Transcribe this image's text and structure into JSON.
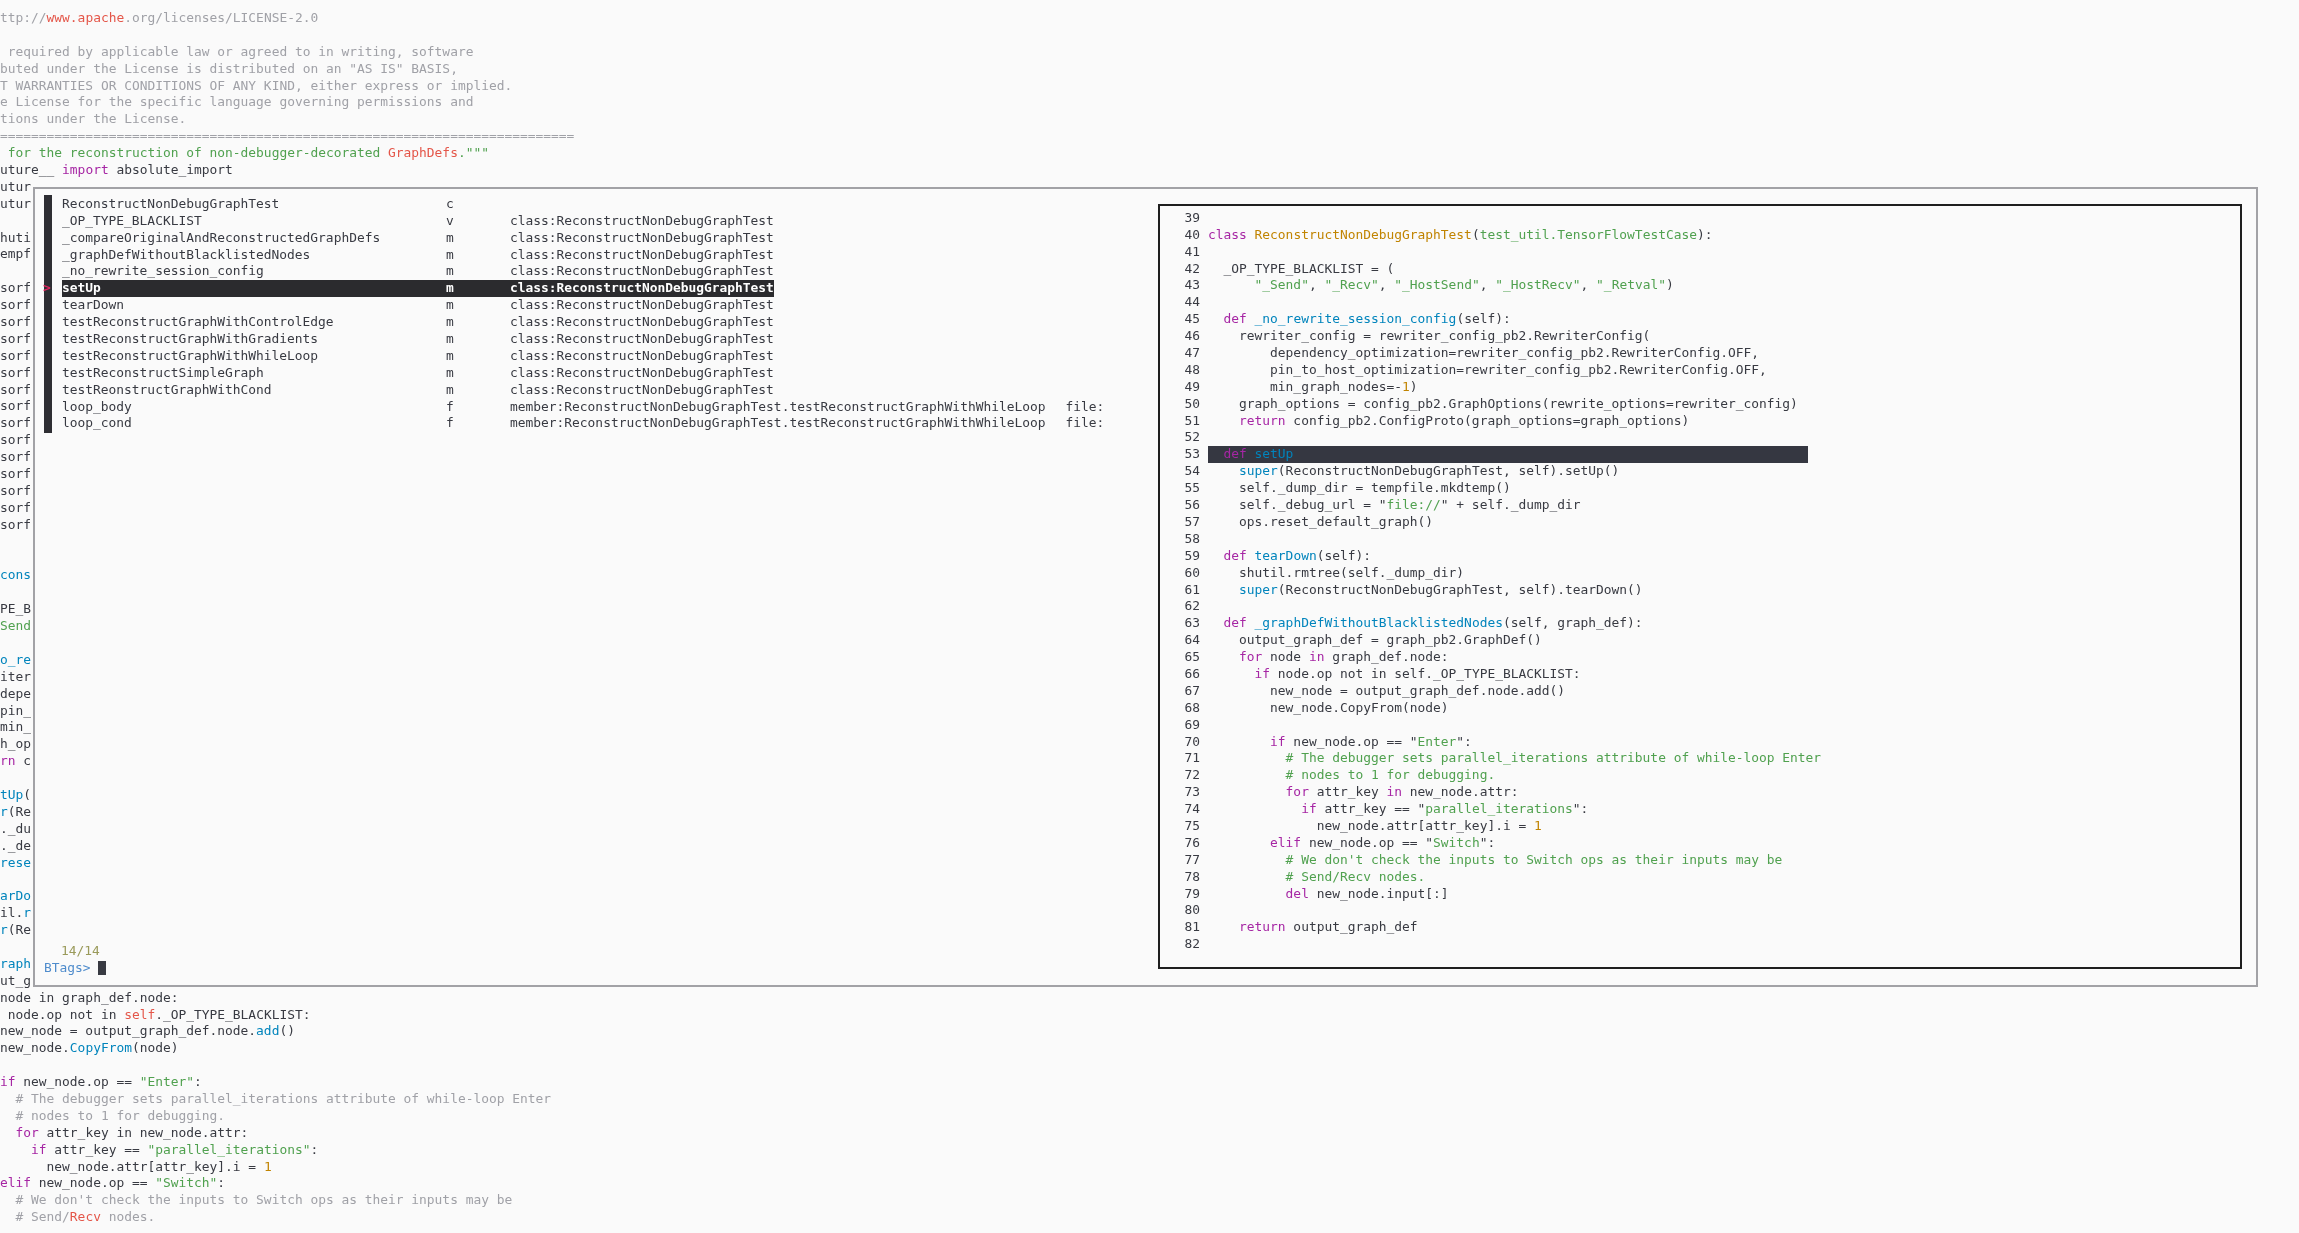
{
  "editor": {
    "top_lines": [
      {
        "kind": "code",
        "segments": [
          {
            "text": "ttp://",
            "kind": "comment"
          },
          {
            "text": "www.apache",
            "kind": "special"
          },
          {
            "text": ".org/licenses/LICENSE-2.0",
            "kind": "comment"
          }
        ]
      },
      {
        "kind": "blank"
      },
      {
        "kind": "code",
        "segments": [
          {
            "text": " required by applicable law or agreed to in writing, software",
            "kind": "comment"
          }
        ]
      },
      {
        "kind": "code",
        "segments": [
          {
            "text": "buted under the License is distributed on an \"AS IS\" BASIS,",
            "kind": "comment"
          }
        ]
      },
      {
        "kind": "code",
        "segments": [
          {
            "text": "T WARRANTIES OR CONDITIONS OF ANY KIND, either express or implied.",
            "kind": "comment"
          }
        ]
      },
      {
        "kind": "code",
        "segments": [
          {
            "text": "e License for the specific language governing permissions and",
            "kind": "comment"
          }
        ]
      },
      {
        "kind": "code",
        "segments": [
          {
            "text": "tions under the License.",
            "kind": "comment"
          }
        ]
      },
      {
        "kind": "code",
        "segments": [
          {
            "text": "==========================================================================",
            "kind": "comment"
          }
        ]
      },
      {
        "kind": "code",
        "segments": [
          {
            "text": " for the reconstruction of non-debugger-decorated ",
            "kind": "string"
          },
          {
            "text": "GraphDefs",
            "kind": "special"
          },
          {
            "text": ".\"\"\"",
            "kind": "string"
          }
        ]
      },
      {
        "kind": "code",
        "segments": [
          {
            "text": "uture__ ",
            "kind": "plain"
          },
          {
            "text": "import",
            "kind": "keyword"
          },
          {
            "text": " absolute_import",
            "kind": "plain"
          }
        ]
      }
    ],
    "side_fragments": [
      {
        "kind": "code",
        "segments": [
          {
            "text": "utur",
            "kind": "plain"
          }
        ]
      },
      {
        "kind": "code",
        "segments": [
          {
            "text": "utur",
            "kind": "plain"
          }
        ]
      },
      {
        "kind": "blank"
      },
      {
        "kind": "code",
        "segments": [
          {
            "text": "huti",
            "kind": "plain"
          }
        ]
      },
      {
        "kind": "code",
        "segments": [
          {
            "text": "empf",
            "kind": "plain"
          }
        ]
      },
      {
        "kind": "blank"
      },
      {
        "kind": "code",
        "segments": [
          {
            "text": "sorf",
            "kind": "plain"
          }
        ]
      },
      {
        "kind": "code",
        "segments": [
          {
            "text": "sorf",
            "kind": "plain"
          }
        ]
      },
      {
        "kind": "code",
        "segments": [
          {
            "text": "sorf",
            "kind": "plain"
          }
        ]
      },
      {
        "kind": "code",
        "segments": [
          {
            "text": "sorf",
            "kind": "plain"
          }
        ]
      },
      {
        "kind": "code",
        "segments": [
          {
            "text": "sorf",
            "kind": "plain"
          }
        ]
      },
      {
        "kind": "code",
        "segments": [
          {
            "text": "sorf",
            "kind": "plain"
          }
        ]
      },
      {
        "kind": "code",
        "segments": [
          {
            "text": "sorf",
            "kind": "plain"
          }
        ]
      },
      {
        "kind": "code",
        "segments": [
          {
            "text": "sorf",
            "kind": "plain"
          }
        ]
      },
      {
        "kind": "code",
        "segments": [
          {
            "text": "sorf",
            "kind": "plain"
          }
        ]
      },
      {
        "kind": "code",
        "segments": [
          {
            "text": "sorf",
            "kind": "plain"
          }
        ]
      },
      {
        "kind": "code",
        "segments": [
          {
            "text": "sorf",
            "kind": "plain"
          }
        ]
      },
      {
        "kind": "code",
        "segments": [
          {
            "text": "sorf",
            "kind": "plain"
          }
        ]
      },
      {
        "kind": "code",
        "segments": [
          {
            "text": "sorf",
            "kind": "plain"
          }
        ]
      },
      {
        "kind": "code",
        "segments": [
          {
            "text": "sorf",
            "kind": "plain"
          }
        ]
      },
      {
        "kind": "code",
        "segments": [
          {
            "text": "sorf",
            "kind": "plain"
          }
        ]
      },
      {
        "kind": "blank"
      },
      {
        "kind": "blank"
      },
      {
        "kind": "code",
        "segments": [
          {
            "text": "cons",
            "kind": "func"
          }
        ]
      },
      {
        "kind": "blank"
      },
      {
        "kind": "code",
        "segments": [
          {
            "text": "PE_B",
            "kind": "plain"
          }
        ]
      },
      {
        "kind": "code",
        "segments": [
          {
            "text": "Send",
            "kind": "string"
          }
        ]
      },
      {
        "kind": "blank"
      },
      {
        "kind": "code",
        "segments": [
          {
            "text": "o_re",
            "kind": "func"
          }
        ]
      },
      {
        "kind": "code",
        "segments": [
          {
            "text": "iter",
            "kind": "plain"
          }
        ]
      },
      {
        "kind": "code",
        "segments": [
          {
            "text": "depe",
            "kind": "plain"
          }
        ]
      },
      {
        "kind": "code",
        "segments": [
          {
            "text": "pin_",
            "kind": "plain"
          }
        ]
      },
      {
        "kind": "code",
        "segments": [
          {
            "text": "min_",
            "kind": "plain"
          }
        ]
      },
      {
        "kind": "code",
        "segments": [
          {
            "text": "h_op",
            "kind": "plain"
          }
        ]
      },
      {
        "kind": "code",
        "segments": [
          {
            "text": "rn",
            "kind": "keyword"
          },
          {
            "text": " c",
            "kind": "plain"
          }
        ]
      },
      {
        "kind": "blank"
      },
      {
        "kind": "code",
        "segments": [
          {
            "text": "tUp",
            "kind": "func"
          },
          {
            "text": "(",
            "kind": "plain"
          }
        ]
      },
      {
        "kind": "code",
        "segments": [
          {
            "text": "r",
            "kind": "func"
          },
          {
            "text": "(Re",
            "kind": "plain"
          }
        ]
      },
      {
        "kind": "code",
        "segments": [
          {
            "text": "._du",
            "kind": "plain"
          }
        ]
      },
      {
        "kind": "code",
        "segments": [
          {
            "text": "._de",
            "kind": "plain"
          }
        ]
      },
      {
        "kind": "code",
        "segments": [
          {
            "text": "rese",
            "kind": "func"
          }
        ]
      },
      {
        "kind": "blank"
      },
      {
        "kind": "code",
        "segments": [
          {
            "text": "arDo",
            "kind": "func"
          }
        ]
      },
      {
        "kind": "code",
        "segments": [
          {
            "text": "il.",
            "kind": "plain"
          },
          {
            "text": "r",
            "kind": "func"
          }
        ]
      },
      {
        "kind": "code",
        "segments": [
          {
            "text": "r",
            "kind": "func"
          },
          {
            "text": "(Re",
            "kind": "plain"
          }
        ]
      },
      {
        "kind": "blank"
      },
      {
        "kind": "code",
        "segments": [
          {
            "text": "raph",
            "kind": "func"
          }
        ]
      },
      {
        "kind": "code",
        "segments": [
          {
            "text": "ut_g",
            "kind": "plain"
          }
        ]
      }
    ],
    "bottom_lines": [
      {
        "kind": "code",
        "segments": [
          {
            "text": "node in graph_def.node:",
            "kind": "plain"
          }
        ]
      },
      {
        "kind": "code",
        "segments": [
          {
            "text": " node.op not in ",
            "kind": "plain"
          },
          {
            "text": "self",
            "kind": "special"
          },
          {
            "text": "._OP_TYPE_BLACKLIST:",
            "kind": "plain"
          }
        ]
      },
      {
        "kind": "code",
        "segments": [
          {
            "text": "new_node = output_graph_def.node.",
            "kind": "plain"
          },
          {
            "text": "add",
            "kind": "func"
          },
          {
            "text": "()",
            "kind": "plain"
          }
        ]
      },
      {
        "kind": "code",
        "segments": [
          {
            "text": "new_node.",
            "kind": "plain"
          },
          {
            "text": "CopyFrom",
            "kind": "func"
          },
          {
            "text": "(node)",
            "kind": "plain"
          }
        ]
      },
      {
        "kind": "blank"
      },
      {
        "kind": "code",
        "segments": [
          {
            "text": "if",
            "kind": "keyword"
          },
          {
            "text": " new_node.op == ",
            "kind": "plain"
          },
          {
            "text": "\"Enter\"",
            "kind": "string"
          },
          {
            "text": ":",
            "kind": "plain"
          }
        ]
      },
      {
        "kind": "code",
        "segments": [
          {
            "text": "  # The debugger sets parallel_iterations attribute of while-loop Enter",
            "kind": "comment"
          }
        ]
      },
      {
        "kind": "code",
        "segments": [
          {
            "text": "  # nodes to 1 for debugging.",
            "kind": "comment"
          }
        ]
      },
      {
        "kind": "code",
        "segments": [
          {
            "text": "  for",
            "kind": "keyword"
          },
          {
            "text": " attr_key in new_node.attr:",
            "kind": "plain"
          }
        ]
      },
      {
        "kind": "code",
        "segments": [
          {
            "text": "    if",
            "kind": "keyword"
          },
          {
            "text": " attr_key == ",
            "kind": "plain"
          },
          {
            "text": "\"parallel_iterations\"",
            "kind": "string"
          },
          {
            "text": ":",
            "kind": "plain"
          }
        ]
      },
      {
        "kind": "code",
        "segments": [
          {
            "text": "      new_node.attr[attr_key].i = ",
            "kind": "plain"
          },
          {
            "text": "1",
            "kind": "number"
          }
        ]
      },
      {
        "kind": "code",
        "segments": [
          {
            "text": "elif",
            "kind": "keyword"
          },
          {
            "text": " new_node.op == ",
            "kind": "plain"
          },
          {
            "text": "\"Switch\"",
            "kind": "string"
          },
          {
            "text": ":",
            "kind": "plain"
          }
        ]
      },
      {
        "kind": "code",
        "segments": [
          {
            "text": "  # We don't check the inputs to Switch ops as their inputs may be",
            "kind": "comment"
          }
        ]
      },
      {
        "kind": "code",
        "segments": [
          {
            "text": "  # Send/",
            "kind": "comment"
          },
          {
            "text": "Recv",
            "kind": "special"
          },
          {
            "text": " nodes.",
            "kind": "comment"
          }
        ]
      }
    ]
  },
  "tag_picker": {
    "selection_marker": ">",
    "rows": [
      {
        "name": "ReconstructNonDebugGraphTest",
        "kind": "c",
        "selected": false
      },
      {
        "name": "_OP_TYPE_BLACKLIST",
        "kind": "v",
        "scope": "class:ReconstructNonDebugGraphTest",
        "selected": false
      },
      {
        "name": "_compareOriginalAndReconstructedGraphDefs",
        "kind": "m",
        "scope": "class:ReconstructNonDebugGraphTest",
        "selected": false
      },
      {
        "name": "_graphDefWithoutBlacklistedNodes",
        "kind": "m",
        "scope": "class:ReconstructNonDebugGraphTest",
        "selected": false
      },
      {
        "name": "_no_rewrite_session_config",
        "kind": "m",
        "scope": "class:ReconstructNonDebugGraphTest",
        "selected": false
      },
      {
        "name": "setUp",
        "kind": "m",
        "scope": "class:ReconstructNonDebugGraphTest",
        "selected": true
      },
      {
        "name": "tearDown",
        "kind": "m",
        "scope": "class:ReconstructNonDebugGraphTest",
        "selected": false
      },
      {
        "name": "testReconstructGraphWithControlEdge",
        "kind": "m",
        "scope": "class:ReconstructNonDebugGraphTest",
        "selected": false
      },
      {
        "name": "testReconstructGraphWithGradients",
        "kind": "m",
        "scope": "class:ReconstructNonDebugGraphTest",
        "selected": false
      },
      {
        "name": "testReconstructGraphWithWhileLoop",
        "kind": "m",
        "scope": "class:ReconstructNonDebugGraphTest",
        "selected": false
      },
      {
        "name": "testReconstructSimpleGraph",
        "kind": "m",
        "scope": "class:ReconstructNonDebugGraphTest",
        "selected": false
      },
      {
        "name": "testReonstructGraphWithCond",
        "kind": "m",
        "scope": "class:ReconstructNonDebugGraphTest",
        "selected": false
      },
      {
        "name": "loop_body",
        "kind": "f",
        "scope": "member:ReconstructNonDebugGraphTest.testReconstructGraphWithWhileLoop",
        "file": "file:",
        "selected": false
      },
      {
        "name": "loop_cond",
        "kind": "f",
        "scope": "member:ReconstructNonDebugGraphTest.testReconstructGraphWithWhileLoop",
        "file": "file:",
        "selected": false
      }
    ],
    "count": "14/14",
    "prompt": "BTags>",
    "preview": [
      {
        "number": "39",
        "highlighted": false
      },
      {
        "number": "40",
        "highlighted": false,
        "segments": [
          {
            "text": "class ",
            "kind": "keyword"
          },
          {
            "text": "ReconstructNonDebugGraphTest",
            "kind": "class"
          },
          {
            "text": "(",
            "kind": "plain"
          },
          {
            "text": "test_util.TensorFlowTestCase",
            "kind": "string"
          },
          {
            "text": "):",
            "kind": "plain"
          }
        ]
      },
      {
        "number": "41",
        "highlighted": false
      },
      {
        "number": "42",
        "highlighted": false,
        "segments": [
          {
            "text": "  _OP_TYPE_BLACKLIST = (",
            "kind": "plain"
          }
        ]
      },
      {
        "number": "43",
        "highlighted": false,
        "segments": [
          {
            "text": "      \"_Send\"",
            "kind": "string"
          },
          {
            "text": ", ",
            "kind": "plain"
          },
          {
            "text": "\"_Recv\"",
            "kind": "string"
          },
          {
            "text": ", ",
            "kind": "plain"
          },
          {
            "text": "\"_HostSend\"",
            "kind": "string"
          },
          {
            "text": ", ",
            "kind": "plain"
          },
          {
            "text": "\"_HostRecv\"",
            "kind": "string"
          },
          {
            "text": ", ",
            "kind": "plain"
          },
          {
            "text": "\"_Retval\"",
            "kind": "string"
          },
          {
            "text": ")",
            "kind": "plain"
          }
        ]
      },
      {
        "number": "44",
        "highlighted": false
      },
      {
        "number": "45",
        "highlighted": false,
        "segments": [
          {
            "text": "  def ",
            "kind": "keyword"
          },
          {
            "text": "_no_rewrite_session_config",
            "kind": "func"
          },
          {
            "text": "(self):",
            "kind": "plain"
          }
        ]
      },
      {
        "number": "46",
        "highlighted": false,
        "segments": [
          {
            "text": "    rewriter_config = rewriter_config_pb2.RewriterConfig(",
            "kind": "plain"
          }
        ]
      },
      {
        "number": "47",
        "highlighted": false,
        "segments": [
          {
            "text": "        dependency_optimization=rewriter_config_pb2.RewriterConfig.OFF,",
            "kind": "plain"
          }
        ]
      },
      {
        "number": "48",
        "highlighted": false,
        "segments": [
          {
            "text": "        pin_to_host_optimization=rewriter_config_pb2.RewriterConfig.OFF,",
            "kind": "plain"
          }
        ]
      },
      {
        "number": "49",
        "highlighted": false,
        "segments": [
          {
            "text": "        min_graph_nodes=-",
            "kind": "plain"
          },
          {
            "text": "1",
            "kind": "number"
          },
          {
            "text": ")",
            "kind": "plain"
          }
        ]
      },
      {
        "number": "50",
        "highlighted": false,
        "segments": [
          {
            "text": "    graph_options = config_pb2.GraphOptions(rewrite_options=rewriter_config)",
            "kind": "plain"
          }
        ]
      },
      {
        "number": "51",
        "highlighted": false,
        "segments": [
          {
            "text": "    return",
            "kind": "keyword"
          },
          {
            "text": " config_pb2.ConfigProto(graph_options=graph_options)",
            "kind": "plain"
          }
        ]
      },
      {
        "number": "52",
        "highlighted": false
      },
      {
        "number": "53",
        "highlighted": true,
        "segments": [
          {
            "text": "  def ",
            "kind": "keyword"
          },
          {
            "text": "setUp",
            "kind": "func"
          }
        ]
      },
      {
        "number": "54",
        "highlighted": false,
        "segments": [
          {
            "text": "    super",
            "kind": "func"
          },
          {
            "text": "(ReconstructNonDebugGraphTest, self).setUp()",
            "kind": "plain"
          }
        ]
      },
      {
        "number": "55",
        "highlighted": false,
        "segments": [
          {
            "text": "    self._dump_dir = tempfile.mkdtemp()",
            "kind": "plain"
          }
        ]
      },
      {
        "number": "56",
        "highlighted": false,
        "segments": [
          {
            "text": "    self._debug_url = \"",
            "kind": "plain"
          },
          {
            "text": "file://",
            "kind": "string"
          },
          {
            "text": "\" + self._dump_dir",
            "kind": "plain"
          }
        ]
      },
      {
        "number": "57",
        "highlighted": false,
        "segments": [
          {
            "text": "    ops.reset_default_graph()",
            "kind": "plain"
          }
        ]
      },
      {
        "number": "58",
        "highlighted": false
      },
      {
        "number": "59",
        "highlighted": false,
        "segments": [
          {
            "text": "  def ",
            "kind": "keyword"
          },
          {
            "text": "tearDown",
            "kind": "func"
          },
          {
            "text": "(self):",
            "kind": "plain"
          }
        ]
      },
      {
        "number": "60",
        "highlighted": false,
        "segments": [
          {
            "text": "    shutil.rmtree(self._dump_dir)",
            "kind": "plain"
          }
        ]
      },
      {
        "number": "61",
        "highlighted": false,
        "segments": [
          {
            "text": "    super",
            "kind": "func"
          },
          {
            "text": "(ReconstructNonDebugGraphTest, self).tearDown()",
            "kind": "plain"
          }
        ]
      },
      {
        "number": "62",
        "highlighted": false
      },
      {
        "number": "63",
        "highlighted": false,
        "segments": [
          {
            "text": "  def ",
            "kind": "keyword"
          },
          {
            "text": "_graphDefWithoutBlacklistedNodes",
            "kind": "func"
          },
          {
            "text": "(self, graph_def):",
            "kind": "plain"
          }
        ]
      },
      {
        "number": "64",
        "highlighted": false,
        "segments": [
          {
            "text": "    output_graph_def = graph_pb2.GraphDef()",
            "kind": "plain"
          }
        ]
      },
      {
        "number": "65",
        "highlighted": false,
        "segments": [
          {
            "text": "    for",
            "kind": "keyword"
          },
          {
            "text": " node ",
            "kind": "plain"
          },
          {
            "text": "in",
            "kind": "keyword"
          },
          {
            "text": " graph_def.node:",
            "kind": "plain"
          }
        ]
      },
      {
        "number": "66",
        "highlighted": false,
        "segments": [
          {
            "text": "      if",
            "kind": "keyword"
          },
          {
            "text": " node.op not in self._OP_TYPE_BLACKLIST:",
            "kind": "plain"
          }
        ]
      },
      {
        "number": "67",
        "highlighted": false,
        "segments": [
          {
            "text": "        new_node = output_graph_def.node.add()",
            "kind": "plain"
          }
        ]
      },
      {
        "number": "68",
        "highlighted": false,
        "segments": [
          {
            "text": "        new_node.CopyFrom(node)",
            "kind": "plain"
          }
        ]
      },
      {
        "number": "69",
        "highlighted": false
      },
      {
        "number": "70",
        "highlighted": false,
        "segments": [
          {
            "text": "        if",
            "kind": "keyword"
          },
          {
            "text": " new_node.op == \"",
            "kind": "plain"
          },
          {
            "text": "Enter",
            "kind": "string"
          },
          {
            "text": "\":",
            "kind": "plain"
          }
        ]
      },
      {
        "number": "71",
        "highlighted": false,
        "segments": [
          {
            "text": "          # The debugger sets parallel_iterations attribute of while-loop Enter",
            "kind": "comment"
          }
        ]
      },
      {
        "number": "72",
        "highlighted": false,
        "segments": [
          {
            "text": "          # nodes to 1 for debugging.",
            "kind": "comment"
          }
        ]
      },
      {
        "number": "73",
        "highlighted": false,
        "segments": [
          {
            "text": "          for",
            "kind": "keyword"
          },
          {
            "text": " attr_key ",
            "kind": "plain"
          },
          {
            "text": "in",
            "kind": "keyword"
          },
          {
            "text": " new_node.attr:",
            "kind": "plain"
          }
        ]
      },
      {
        "number": "74",
        "highlighted": false,
        "segments": [
          {
            "text": "            if",
            "kind": "keyword"
          },
          {
            "text": " attr_key == \"",
            "kind": "plain"
          },
          {
            "text": "parallel_iterations",
            "kind": "string"
          },
          {
            "text": "\":",
            "kind": "plain"
          }
        ]
      },
      {
        "number": "75",
        "highlighted": false,
        "segments": [
          {
            "text": "              new_node.attr[attr_key].i = ",
            "kind": "plain"
          },
          {
            "text": "1",
            "kind": "number"
          }
        ]
      },
      {
        "number": "76",
        "highlighted": false,
        "segments": [
          {
            "text": "        elif",
            "kind": "keyword"
          },
          {
            "text": " new_node.op == \"",
            "kind": "plain"
          },
          {
            "text": "Switch",
            "kind": "string"
          },
          {
            "text": "\":",
            "kind": "plain"
          }
        ]
      },
      {
        "number": "77",
        "highlighted": false,
        "segments": [
          {
            "text": "          # We don't check the inputs to Switch ops as their inputs may be",
            "kind": "comment"
          }
        ]
      },
      {
        "number": "78",
        "highlighted": false,
        "segments": [
          {
            "text": "          # Send/Recv nodes.",
            "kind": "comment"
          }
        ]
      },
      {
        "number": "79",
        "highlighted": false,
        "segments": [
          {
            "text": "          del",
            "kind": "keyword"
          },
          {
            "text": " new_node.input[:]",
            "kind": "plain"
          }
        ]
      },
      {
        "number": "80",
        "highlighted": false
      },
      {
        "number": "81",
        "highlighted": false,
        "segments": [
          {
            "text": "    return",
            "kind": "keyword"
          },
          {
            "text": " output_graph_def",
            "kind": "plain"
          }
        ]
      },
      {
        "number": "82",
        "highlighted": false
      }
    ]
  }
}
